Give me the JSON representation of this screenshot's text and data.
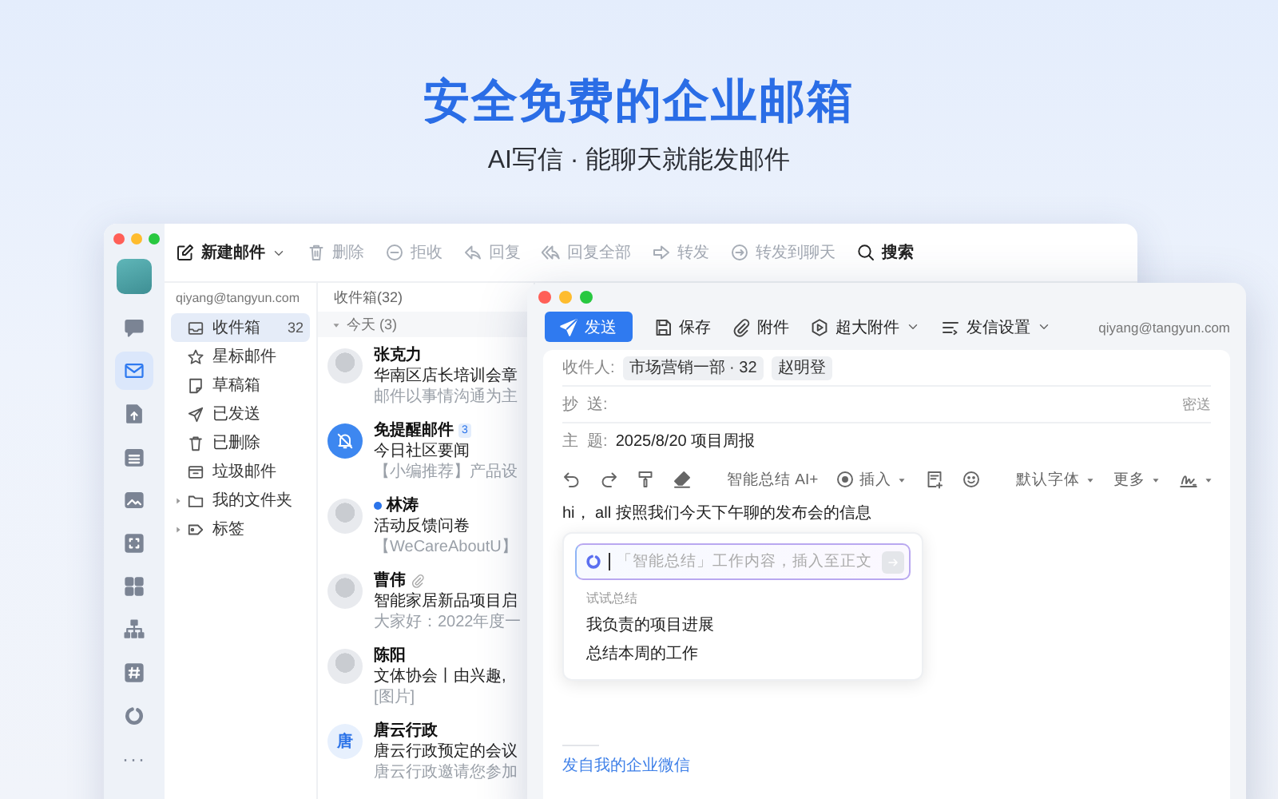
{
  "promo": {
    "headline": "安全免费的企业邮箱",
    "tagline": "AI写信 · 能聊天就能发邮件"
  },
  "main_window": {
    "rail": [
      {
        "kind": "chat",
        "selected": false
      },
      {
        "kind": "mail",
        "selected": true
      },
      {
        "kind": "document",
        "selected": false
      },
      {
        "kind": "calendar",
        "selected": false
      },
      {
        "kind": "image",
        "selected": false
      },
      {
        "kind": "frame",
        "selected": false
      },
      {
        "kind": "grid",
        "selected": false
      },
      {
        "kind": "org",
        "selected": false
      },
      {
        "kind": "hash",
        "selected": false
      },
      {
        "kind": "ring",
        "selected": false
      },
      {
        "kind": "more",
        "label": "···",
        "selected": false
      }
    ],
    "toolbar": [
      {
        "kind": "compose",
        "label": "新建邮件",
        "disabled": false,
        "has_menu": true
      },
      {
        "kind": "delete",
        "label": "删除",
        "disabled": true,
        "has_menu": false
      },
      {
        "kind": "reject",
        "label": "拒收",
        "disabled": true,
        "has_menu": false
      },
      {
        "kind": "reply",
        "label": "回复",
        "disabled": true,
        "has_menu": false
      },
      {
        "kind": "reply_all",
        "label": "回复全部",
        "disabled": true,
        "has_menu": false
      },
      {
        "kind": "forward",
        "label": "转发",
        "disabled": true,
        "has_menu": false
      },
      {
        "kind": "forward_chat",
        "label": "转发到聊天",
        "disabled": true,
        "has_menu": false
      },
      {
        "kind": "search",
        "label": "搜索",
        "disabled": false,
        "has_menu": false
      }
    ],
    "account": "qiyang@tangyun.com",
    "folders": [
      {
        "kind": "inbox",
        "label": "收件箱",
        "count": "32",
        "selected": true,
        "expandable": false
      },
      {
        "kind": "star",
        "label": "星标邮件",
        "selected": false,
        "expandable": false
      },
      {
        "kind": "draft",
        "label": "草稿箱",
        "selected": false,
        "expandable": false
      },
      {
        "kind": "sent",
        "label": "已发送",
        "selected": false,
        "expandable": false
      },
      {
        "kind": "trash",
        "label": "已删除",
        "selected": false,
        "expandable": false
      },
      {
        "kind": "junk",
        "label": "垃圾邮件",
        "selected": false,
        "expandable": false
      },
      {
        "kind": "folder",
        "label": "我的文件夹",
        "selected": false,
        "expandable": true
      },
      {
        "kind": "tag",
        "label": "标签",
        "selected": false,
        "expandable": true
      }
    ],
    "list": {
      "title": "收件箱(32)",
      "group": {
        "label": "今天 (3)",
        "expanded": true
      },
      "items": [
        {
          "kind": "photo",
          "sender": "张克力",
          "subject": "华南区店长培训会章",
          "preview": "邮件以事情沟通为主",
          "unread": false,
          "has_attachment": false
        },
        {
          "kind": "bell",
          "sender": "免提醒邮件",
          "badge": "3",
          "subject": "今日社区要闻",
          "preview": "【小编推荐】产品设",
          "unread": false,
          "has_attachment": false
        },
        {
          "kind": "photo",
          "sender": "林涛",
          "subject": "活动反馈问卷",
          "preview": "【WeCareAboutU】",
          "unread": true,
          "has_attachment": false
        },
        {
          "kind": "photo",
          "sender": "曹伟",
          "subject": "智能家居新品项目启",
          "preview": "大家好：2022年度一",
          "unread": false,
          "has_attachment": true
        },
        {
          "kind": "photo",
          "sender": "陈阳",
          "subject": "文体协会丨由兴趣,",
          "preview": "[图片]",
          "unread": false,
          "has_attachment": false
        },
        {
          "kind": "initial",
          "initial": "唐",
          "sender": "唐云行政",
          "subject": "唐云行政预定的会议",
          "preview": "唐云行政邀请您参加",
          "unread": false,
          "has_attachment": false
        }
      ]
    }
  },
  "compose": {
    "toolbar": [
      {
        "kind": "send",
        "label": "发送",
        "primary": true,
        "has_menu": false
      },
      {
        "kind": "save",
        "label": "保存",
        "primary": false,
        "has_menu": false
      },
      {
        "kind": "attach",
        "label": "附件",
        "primary": false,
        "has_menu": false
      },
      {
        "kind": "large_attach",
        "label": "超大附件",
        "primary": false,
        "has_menu": true
      },
      {
        "kind": "settings",
        "label": "发信设置",
        "primary": false,
        "has_menu": true
      }
    ],
    "from": "qiyang@tangyun.com",
    "to_label": "收件人:",
    "recipients": [
      "市场营销一部 · 32",
      "赵明登"
    ],
    "cc_label": "抄  送:",
    "bcc": "密送",
    "subject_label": "主  题:",
    "subject": "2025/8/20 项目周报",
    "format_toolbar": [
      {
        "kind": "undo"
      },
      {
        "kind": "redo"
      },
      {
        "kind": "paint"
      },
      {
        "kind": "eraser"
      },
      {
        "kind": "divider"
      },
      {
        "kind": "ai",
        "label": "智能总结 AI+"
      },
      {
        "kind": "insert",
        "label": "插入",
        "has_menu": true
      },
      {
        "kind": "note"
      },
      {
        "kind": "emoji"
      },
      {
        "kind": "divider"
      },
      {
        "kind": "font",
        "label": "默认字体",
        "has_menu": true
      },
      {
        "kind": "more",
        "label": "更多",
        "has_menu": true
      },
      {
        "kind": "signature",
        "has_menu": true
      }
    ],
    "body": "hi， all  按照我们今天下午聊的发布会的信息",
    "ai_popup": {
      "placeholder": "「智能总结」工作内容，插入至正文",
      "section": "试试总结",
      "suggestions": [
        "我负责的项目进展",
        "总结本周的工作"
      ]
    },
    "signature": "发自我的企业微信"
  }
}
